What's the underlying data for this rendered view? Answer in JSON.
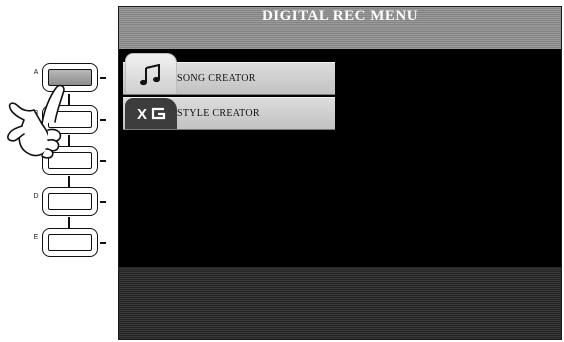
{
  "screen": {
    "title": "DIGITAL REC MENU",
    "menu_items": [
      {
        "label": "SONG CREATOR",
        "icon": "musical-note-icon"
      },
      {
        "label": "STYLE CREATOR",
        "icon": "xg-logo-icon"
      }
    ]
  },
  "panel": {
    "buttons": [
      {
        "letter": "A",
        "pressed": true
      },
      {
        "letter": "B",
        "pressed": false
      },
      {
        "letter": "C",
        "pressed": false
      },
      {
        "letter": "D",
        "pressed": false
      },
      {
        "letter": "E",
        "pressed": false
      }
    ],
    "pointer": "pointing-hand-icon"
  },
  "colors": {
    "screen_bg": "#000000",
    "title_bar": "#8d8d8d",
    "menu_item": "#c8c8c8"
  }
}
